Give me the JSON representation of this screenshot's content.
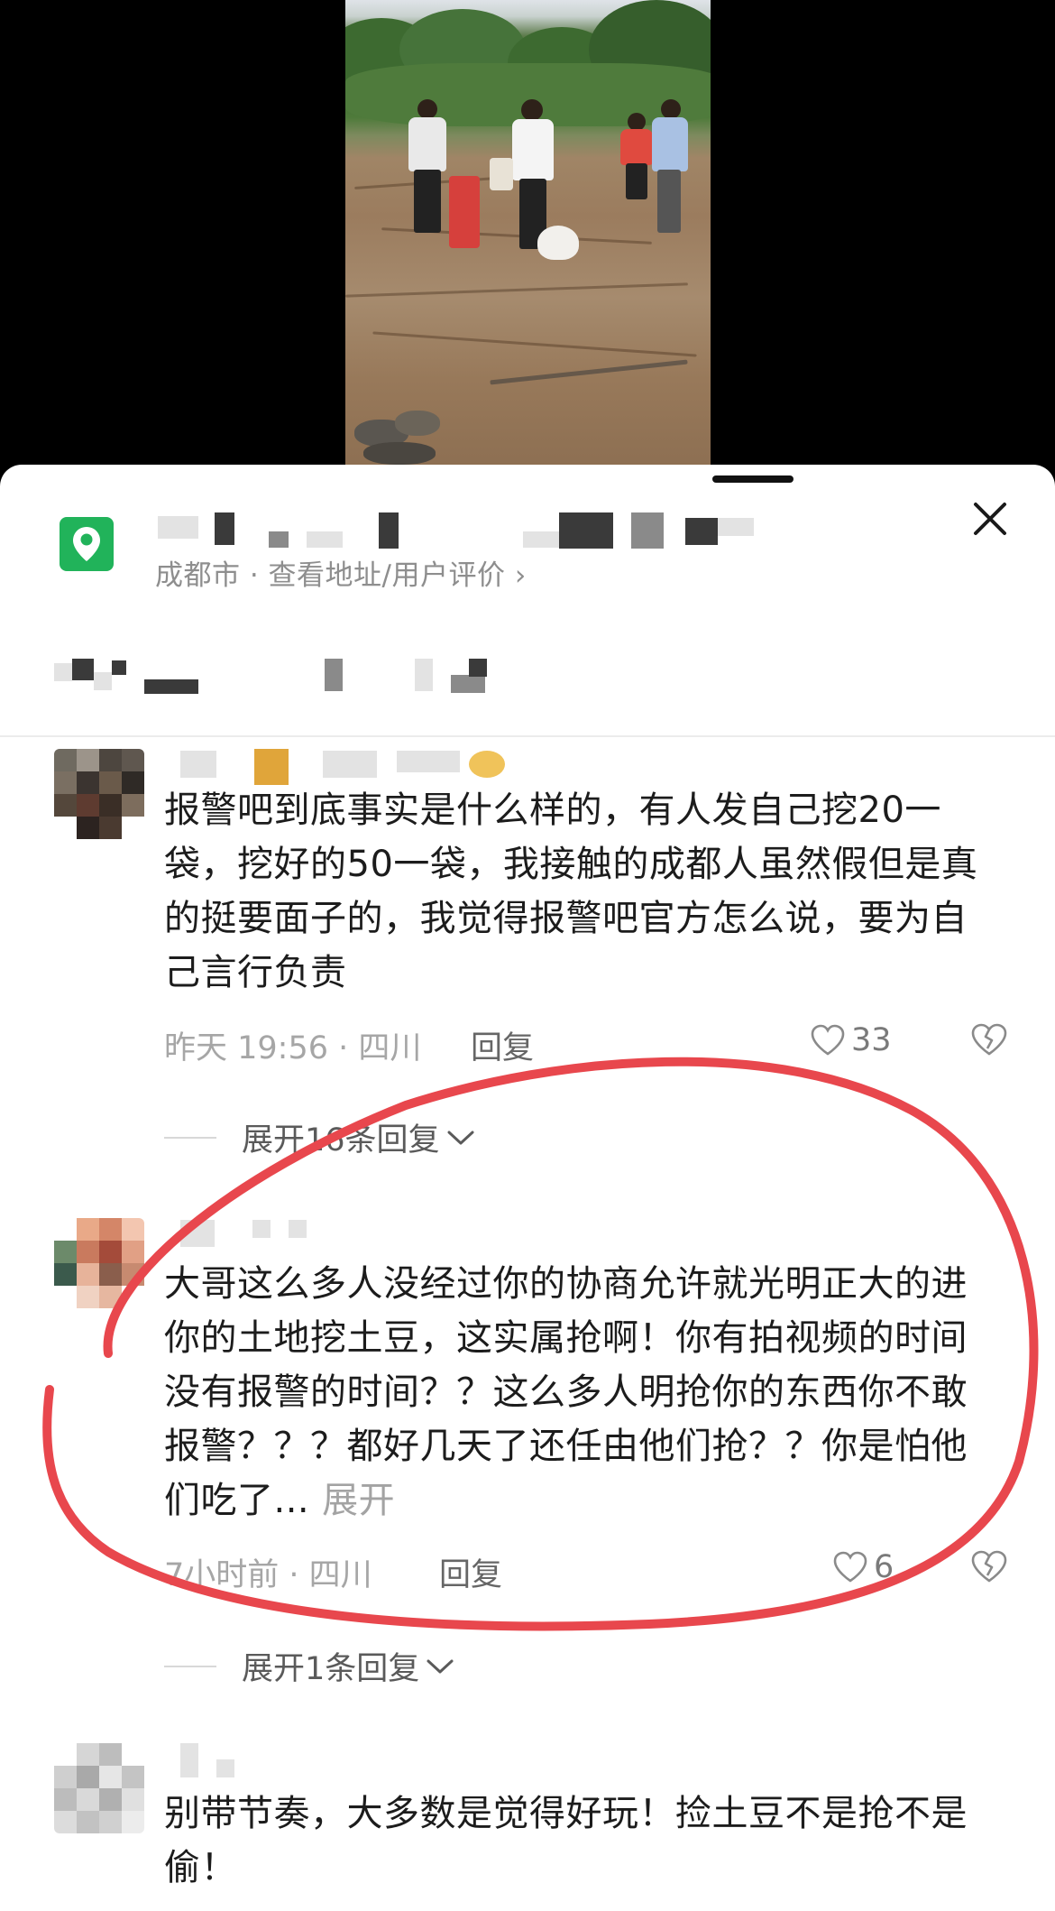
{
  "location": {
    "city_line": "成都市 · 查看地址/用户评价",
    "chevron": "›"
  },
  "icons": {
    "pin": "map-pin-icon",
    "close": "close-icon",
    "heart": "heart-icon",
    "dislike": "broken-heart-icon",
    "chevron": "chevron-down-icon"
  },
  "colors": {
    "pin_badge": "#21b35a",
    "annotation_circle": "#e8474d"
  },
  "comments": [
    {
      "text": "报警吧到底事实是什么样的，有人发自己挖20一袋，挖好的50一袋，我接触的成都人虽然假但是真的挺要面子的，我觉得报警吧官方怎么说，要为自己言行负责",
      "meta": "昨天 19:56 · 四川",
      "reply": "回复",
      "likes": "33",
      "expand": "展开16条回复"
    },
    {
      "text": "大哥这么多人没经过你的协商允许就光明正大的进你的土地挖土豆，这实属抢啊！你有拍视频的时间没有报警的时间？？这么多人明抢你的东西你不敢报警？？？都好几天了还任由他们抢？？你是怕他们吃了...",
      "inline_expand": "展开",
      "meta": "7小时前 · 四川",
      "reply": "回复",
      "likes": "6",
      "expand": "展开1条回复"
    },
    {
      "text": "别带节奏，大多数是觉得好玩！捡土豆不是抢不是偷！"
    }
  ]
}
